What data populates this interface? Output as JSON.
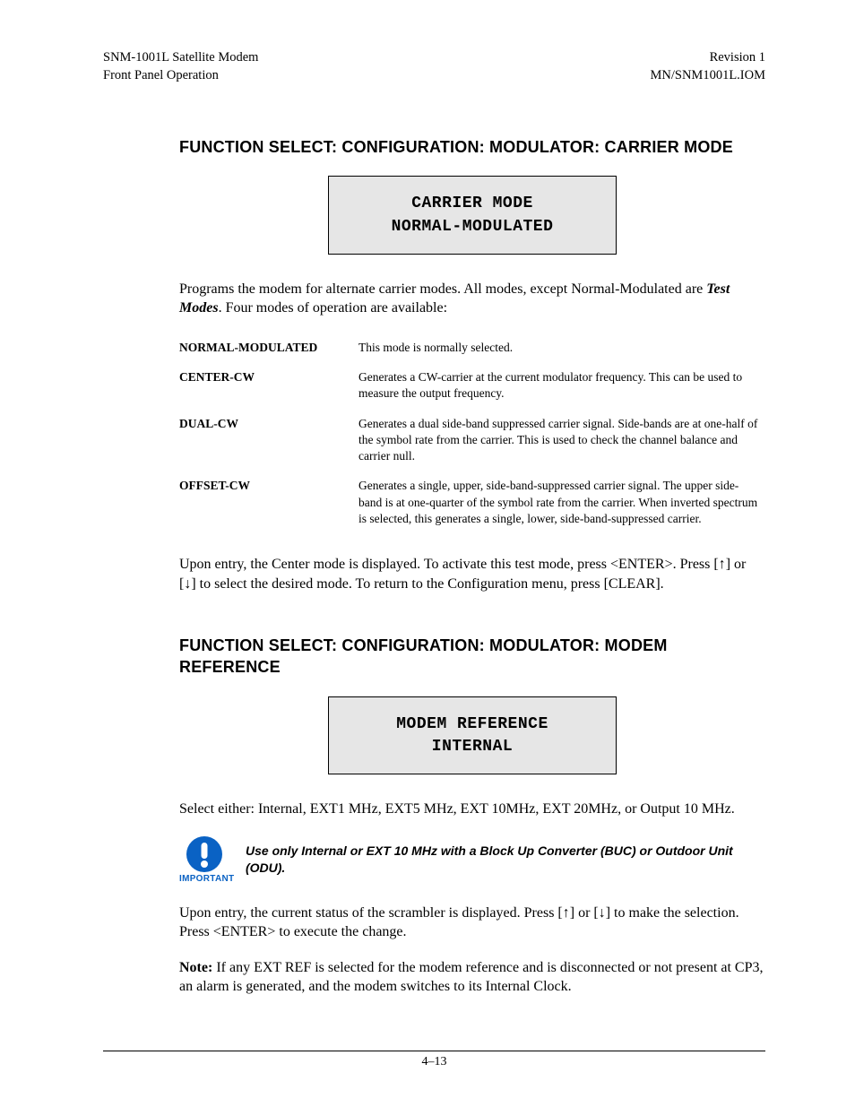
{
  "header": {
    "left_line1": "SNM-1001L Satellite Modem",
    "left_line2": "Front Panel Operation",
    "right_line1": "Revision 1",
    "right_line2": "MN/SNM1001L.IOM"
  },
  "section1": {
    "heading": "FUNCTION SELECT: CONFIGURATION: MODULATOR: CARRIER MODE",
    "lcd_line1": "CARRIER MODE",
    "lcd_line2": "NORMAL-MODULATED",
    "intro_pre": "Programs the modem for alternate carrier modes. All modes, except Normal-Modulated are ",
    "intro_test_modes": "Test Modes",
    "intro_post": ". Four modes of operation are available:",
    "modes": [
      {
        "name": "NORMAL-MODULATED",
        "desc": "This mode is normally selected."
      },
      {
        "name": "CENTER-CW",
        "desc": "Generates a CW-carrier at the current modulator frequency. This can be used to measure the output frequency."
      },
      {
        "name": "DUAL-CW",
        "desc": "Generates a dual side-band suppressed carrier signal. Side-bands are at one-half of the symbol rate from the carrier. This is used to check the channel balance and carrier null."
      },
      {
        "name": "OFFSET-CW",
        "desc": "Generates a single, upper, side-band-suppressed carrier signal. The upper side-band is at one-quarter of the symbol rate from the carrier. When inverted spectrum is selected, this generates a single, lower, side-band-suppressed carrier."
      }
    ],
    "outro": "Upon entry, the Center mode is displayed. To activate this test mode, press <ENTER>. Press [↑] or [↓] to select the desired mode. To return to the Configuration menu, press [CLEAR]."
  },
  "section2": {
    "heading": "FUNCTION SELECT: CONFIGURATION: MODULATOR: MODEM REFERENCE",
    "lcd_line1": "MODEM REFERENCE",
    "lcd_line2": "INTERNAL",
    "select_text": "Select either: Internal, EXT1 MHz, EXT5 MHz, EXT 10MHz, EXT 20MHz, or Output 10 MHz.",
    "important_label": "IMPORTANT",
    "important_text": "Use only Internal or EXT 10 MHz with a Block Up Converter (BUC) or Outdoor Unit (ODU).",
    "entry_text": "Upon entry, the current status of the scrambler is displayed. Press [↑] or [↓] to make the selection. Press <ENTER> to execute the change.",
    "note_label": "Note:",
    "note_text": " If any EXT REF is selected for the modem reference and is disconnected or not present at CP3, an alarm is generated, and the modem switches to its Internal Clock."
  },
  "footer": {
    "page_number": "4–13"
  }
}
